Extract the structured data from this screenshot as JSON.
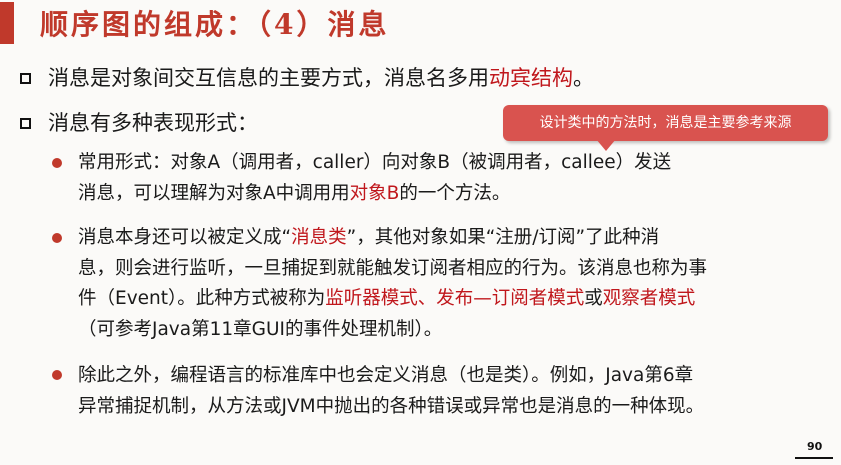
{
  "title": "顺序图的组成：（4）消息",
  "bullets": {
    "b1": {
      "pre": "消息是对象间交互信息的主要方式，消息名多用",
      "red": "动宾结构",
      "post": "。"
    },
    "b2": {
      "text": "消息有多种表现形式："
    }
  },
  "callout": {
    "text": "设计类中的方法时，消息是主要参考来源"
  },
  "sub": {
    "s1": {
      "line1": "常用形式：对象A（调用者，caller）向对象B（被调用者，callee）发送",
      "line2_pre": "消息，可以理解为对象A中调用用",
      "line2_red": "对象B",
      "line2_post": "的一个方法。"
    },
    "s2": {
      "line1_pre": "消息本身还可以被定义成“",
      "line1_red": "消息类",
      "line1_post": "”，其他对象如果“注册/订阅”了此种消",
      "line2": "息，则会进行监听，一旦捕捉到就能触发订阅者相应的行为。该消息也称为事",
      "line3_pre": "件（Event）。此种方式被称为",
      "line3_red1": "监听器模式、发布—订阅者模式",
      "line3_mid": "或",
      "line3_red2": "观察者模式",
      "line4": "（可参考Java第11章GUI的事件处理机制）。"
    },
    "s3": {
      "line1": "除此之外，编程语言的标准库中也会定义消息（也是类）。例如，Java第6章",
      "line2": "异常捕捉机制，从方法或JVM中抛出的各种错误或异常也是消息的一种体现。"
    }
  },
  "page_number": "90",
  "colors": {
    "accent": "#c0392b",
    "highlight": "#c0171c",
    "callout_bg": "#d9534f"
  }
}
